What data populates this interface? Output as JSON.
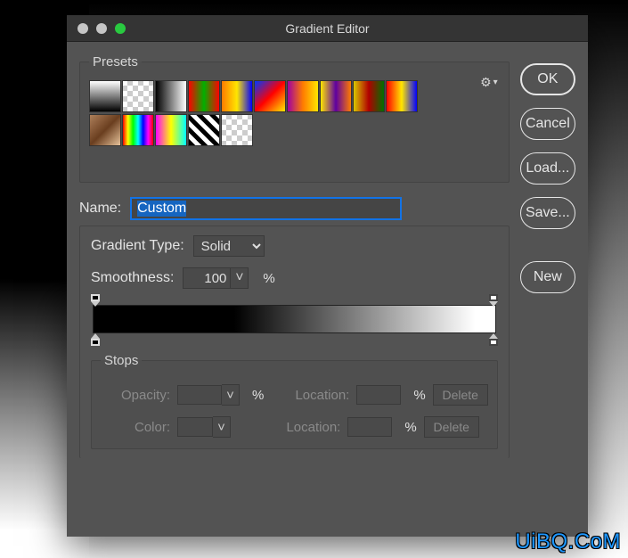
{
  "window": {
    "title": "Gradient Editor"
  },
  "presets": {
    "label": "Presets"
  },
  "icons": {
    "gear": "⚙",
    "caret": "▾",
    "chevron": "˅"
  },
  "buttons": {
    "ok": "OK",
    "cancel": "Cancel",
    "load": "Load...",
    "save": "Save...",
    "newbtn": "New"
  },
  "name": {
    "label": "Name:",
    "value": "Custom"
  },
  "gradient_type": {
    "label": "Gradient Type:",
    "value": "Solid"
  },
  "smoothness": {
    "label": "Smoothness:",
    "value": "100",
    "unit": "%"
  },
  "stops": {
    "legend": "Stops",
    "opacity_label": "Opacity:",
    "color_label": "Color:",
    "location_label": "Location:",
    "pct": "%",
    "delete": "Delete"
  },
  "swatch_css": [
    "linear-gradient(to bottom,#fff,#000)",
    "repeating-conic-gradient(#ccc 0 25%,#fff 0 50%) 50%/12px 12px,linear-gradient(to right,#000,#fff)",
    "linear-gradient(to right,#000,#fff)",
    "linear-gradient(to right,#ff0000,#00b000,#ff0000)",
    "linear-gradient(to right,#ff7b00,#ffe600,#0000ff)",
    "linear-gradient(135deg,#0038ff,#ff0000,#ffea00)",
    "linear-gradient(to right,#a000a0,#ff7b00,#ffe600)",
    "linear-gradient(to right,#ffe600,#5e00a0,#ff7b00)",
    "linear-gradient(to right,#d8c800,#b10000,#007000)",
    "linear-gradient(to right,#ff0000,#ffe600,#0000ff)",
    "linear-gradient(135deg,#ad7f5a,#6a3e1f,#e6c29a)",
    "linear-gradient(to right,#ff0000,#ffff00,#00ff00,#00ffff,#0000ff,#ff00ff,#ff0000)",
    "linear-gradient(to right,#ff00ff,#ffff00,#00ffff)",
    "repeating-linear-gradient(45deg,#000 0 5px,#fff 5px 10px)",
    "repeating-conic-gradient(#ccc 0 25%,#fff 0 50%) 50%/12px 12px"
  ],
  "watermark": "UiBQ.CoM"
}
